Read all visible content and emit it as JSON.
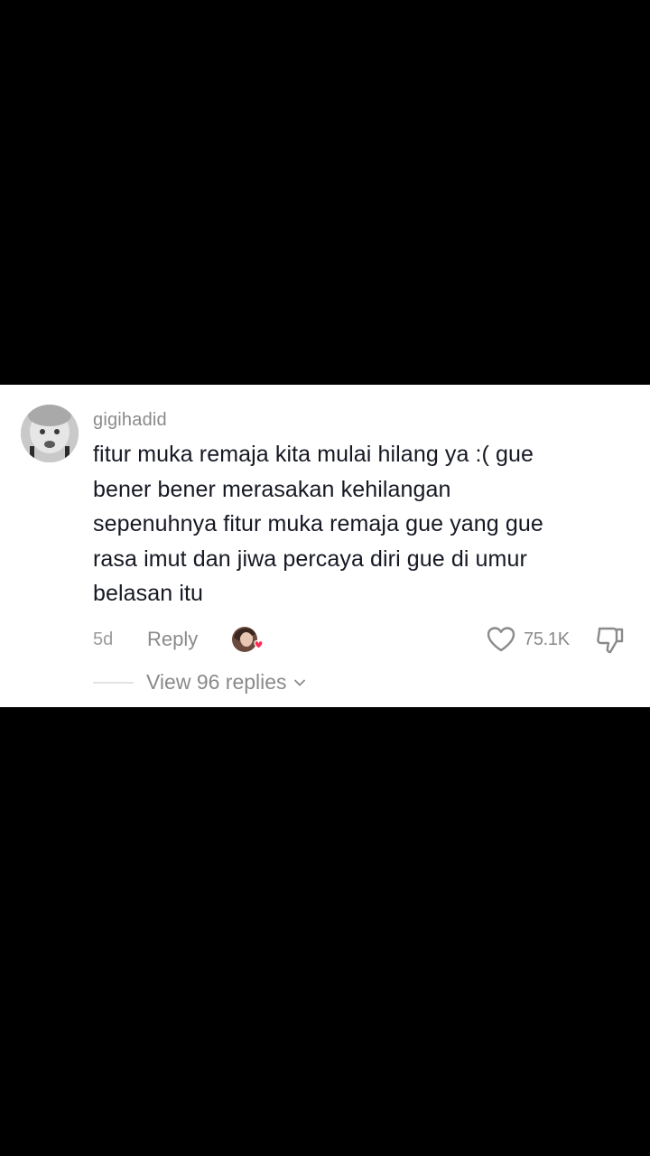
{
  "comment": {
    "username": "gigihadid",
    "text": "fitur muka remaja kita mulai hilang ya :( gue bener bener merasakan kehilangan sepenuhnya fitur muka remaja gue yang gue rasa imut dan jiwa percaya diri gue di umur belasan itu",
    "lines": [
      "fitur muka remaja kita mulai hilang ya :( gue",
      "bener bener merasakan kehilangan",
      "sepenuhnya fitur muka remaja gue yang gue",
      "rasa imut dan jiwa percaya diri gue di umur",
      "belasan itu"
    ],
    "time_ago": "5d",
    "reply_label": "Reply",
    "like_count": "75.1K",
    "view_replies_label": "View 96 replies"
  },
  "icons": {
    "avatar": "user-avatar",
    "creator_liked": "creator-liked-avatar-icon",
    "like": "heart-outline-icon",
    "dislike": "thumbs-down-outline-icon",
    "expand": "chevron-down-icon"
  },
  "colors": {
    "background": "#000000",
    "card": "#ffffff",
    "text_primary": "#161823",
    "text_secondary": "#8a8a8a",
    "heart_badge": "#fe2c55"
  }
}
